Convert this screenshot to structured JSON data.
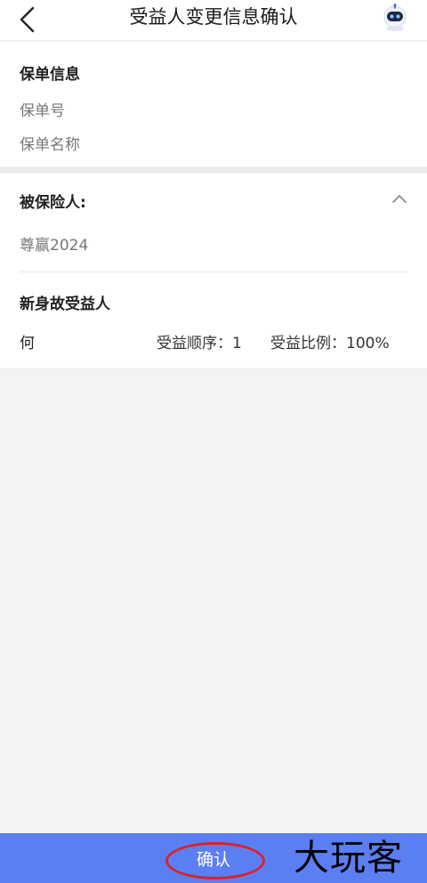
{
  "header": {
    "title": "受益人变更信息确认",
    "back_icon": "chevron-left-icon",
    "robot_icon": "robot-assistant-icon"
  },
  "policy": {
    "section_title": "保单信息",
    "policy_number_label": "保单号",
    "policy_name_label": "保单名称"
  },
  "insured": {
    "section_title": "被保险人:",
    "product_name": "尊赢2024",
    "collapse_icon": "chevron-up-icon"
  },
  "beneficiary": {
    "section_title": "新身故受益人",
    "name": "何",
    "order": "受益顺序：1",
    "ratio": "受益比例：100%"
  },
  "footer": {
    "confirm_label": "确认",
    "watermark": "大玩客",
    "bar_color": "#5b7ff2",
    "highlight_color": "#d8232a"
  }
}
